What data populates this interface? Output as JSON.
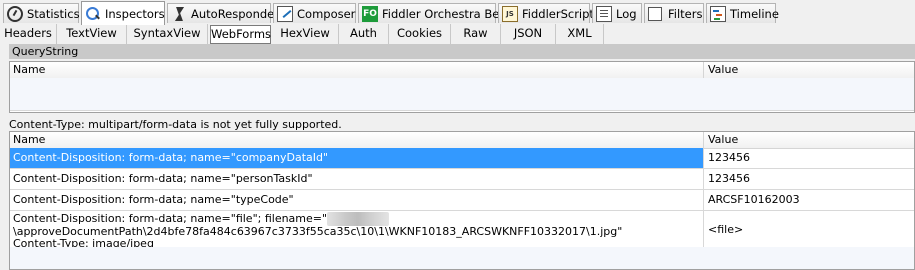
{
  "tabs": [
    {
      "label": "Statistics",
      "icon": "stopwatch-icon"
    },
    {
      "label": "Inspectors",
      "icon": "magnifier-icon",
      "active": true
    },
    {
      "label": "AutoResponder",
      "icon": "lightning-icon"
    },
    {
      "label": "Composer",
      "icon": "pencil-icon"
    },
    {
      "label": "Fiddler Orchestra Beta",
      "icon": "fo-icon",
      "icon_text": "FO"
    },
    {
      "label": "FiddlerScript",
      "icon": "js-icon",
      "icon_text": "JS"
    },
    {
      "label": "Log",
      "icon": "log-icon"
    },
    {
      "label": "Filters",
      "icon": "checkbox-icon"
    },
    {
      "label": "Timeline",
      "icon": "timeline-icon"
    }
  ],
  "subtabs": [
    "Headers",
    "TextView",
    "SyntaxView",
    "WebForms",
    "HexView",
    "Auth",
    "Cookies",
    "Raw",
    "JSON",
    "XML"
  ],
  "active_subtab": "WebForms",
  "querystring": {
    "caption": "QueryString",
    "col_name": "Name",
    "col_value": "Value"
  },
  "form": {
    "caption": "Content-Type: multipart/form-data is not yet fully supported.",
    "col_name": "Name",
    "col_value": "Value",
    "rows": [
      {
        "name": "Content-Disposition: form-data; name=\"companyDataId\"",
        "value": "123456",
        "selected": true
      },
      {
        "name": "Content-Disposition: form-data; name=\"personTaskId\"",
        "value": "123456"
      },
      {
        "name": "Content-Disposition: form-data; name=\"typeCode\"",
        "value": "ARCSF10162003"
      },
      {
        "name_line1": "Content-Disposition: form-data; name=\"file\"; filename=\"",
        "name_line2": "\\approveDocumentPath\\2d4bfe78fa484c63967c3733f55ca35c\\10\\1\\WKNF10183_ARCSWKNFF10332017\\1.jpg\"",
        "name_line3": "Content-Type: image/jpeg",
        "value": "<file>"
      }
    ]
  },
  "colors": {
    "selection": "#3399ff",
    "section_header": "#c9c9c9",
    "grid_fill": "#f4f7fc"
  }
}
